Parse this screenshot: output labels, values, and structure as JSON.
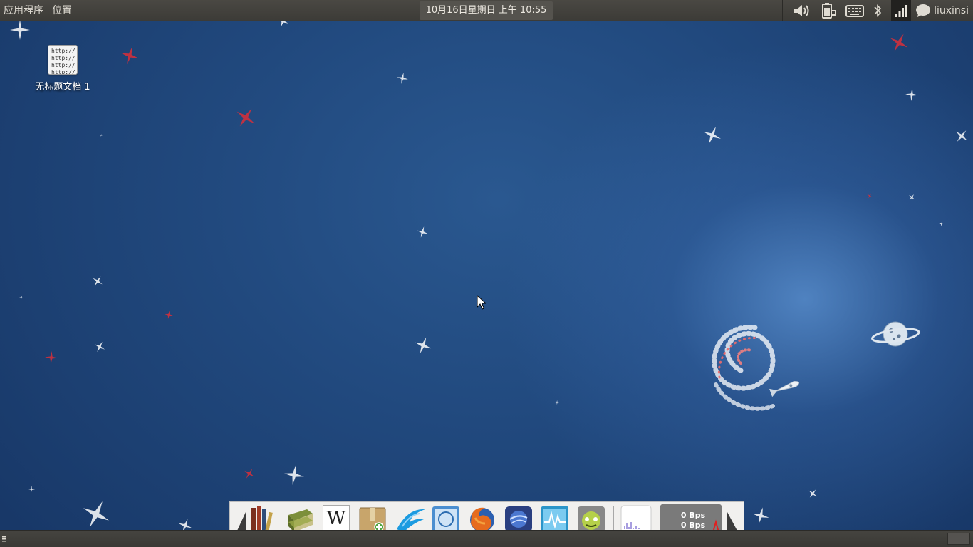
{
  "top_panel": {
    "menu_applications": "应用程序",
    "menu_places": "位置",
    "clock": "10月16日星期日 上午 10:55",
    "user_name": "liuxinsi",
    "icons": [
      "volume-icon",
      "battery-icon",
      "keyboard-icon",
      "bluetooth-icon",
      "signal-icon",
      "chat-icon"
    ]
  },
  "desktop": {
    "file_icon": {
      "label": "无标题文档 1",
      "preview_lines": [
        "http://",
        "http://",
        "http://",
        "http://"
      ]
    }
  },
  "dock": {
    "apps": [
      "bookshelf-icon",
      "books-icon",
      "wikipedia-icon",
      "archive-manager-icon",
      "bird-client-icon",
      "browser-window-icon",
      "firefox-icon",
      "web-globe-icon",
      "system-monitor-icon",
      "android-icon"
    ],
    "wikipedia_letter": "W",
    "net_up": "0 Bps",
    "net_down": "0 Bps"
  },
  "colors": {
    "panel": "#3c3b37",
    "panel_text": "#dfdbd2",
    "wallpaper": "#21497e",
    "dock": "#f1f0ee"
  }
}
